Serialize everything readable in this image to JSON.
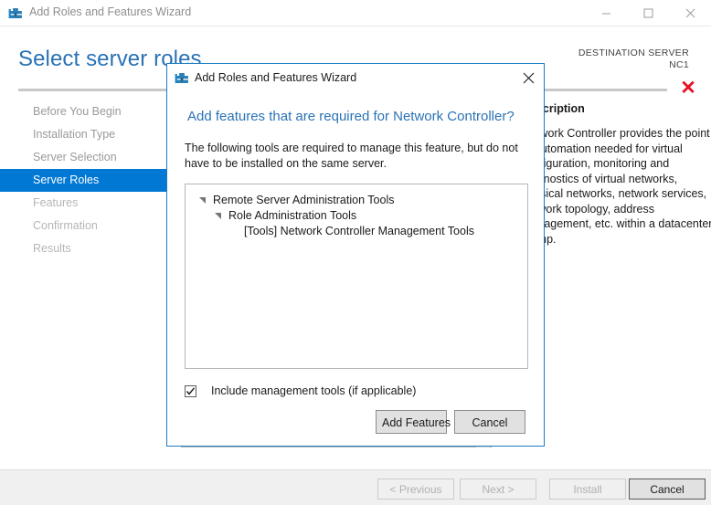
{
  "window": {
    "title": "Add Roles and Features Wizard",
    "icon": "toolbox-icon",
    "controls": {
      "minimize": "minimize-icon",
      "maximize": "maximize-icon",
      "close": "close-icon"
    }
  },
  "page": {
    "title": "Select server roles",
    "destination_label": "DESTINATION SERVER",
    "destination_server": "NC1",
    "error_marker": "✕"
  },
  "nav": {
    "items": [
      {
        "label": "Before You Begin",
        "state": "visited"
      },
      {
        "label": "Installation Type",
        "state": "visited"
      },
      {
        "label": "Server Selection",
        "state": "visited"
      },
      {
        "label": "Server Roles",
        "state": "selected"
      },
      {
        "label": "Features",
        "state": "disabled"
      },
      {
        "label": "Confirmation",
        "state": "disabled"
      },
      {
        "label": "Results",
        "state": "disabled"
      }
    ]
  },
  "description_panel": {
    "title": "Description",
    "body": "Network Controller provides the point of automation needed for virtual configuration, monitoring and diagnostics of virtual networks, physical networks, network services, network topology, address management, etc. within a datacenter stamp."
  },
  "dialog": {
    "title": "Add Roles and Features Wizard",
    "icon": "toolbox-icon",
    "close_icon": "close-icon",
    "heading": "Add features that are required for Network Controller?",
    "body": "The following tools are required to manage this feature, but do not have to be installed on the same server.",
    "tree": [
      {
        "label": "Remote Server Administration Tools",
        "level": 0,
        "expanded": true
      },
      {
        "label": "Role Administration Tools",
        "level": 1,
        "expanded": true
      },
      {
        "label": "[Tools] Network Controller Management Tools",
        "level": 2,
        "expanded": false
      }
    ],
    "checkbox": {
      "label": "Include management tools (if applicable)",
      "checked": true
    },
    "buttons": {
      "add_features": "Add Features",
      "cancel": "Cancel"
    }
  },
  "footer": {
    "previous": "< Previous",
    "next": "Next >",
    "install": "Install",
    "cancel": "Cancel"
  },
  "colors": {
    "accent": "#0078d4",
    "heading_blue": "#2a72b5",
    "error_red": "#e81123",
    "dialog_border": "#1d7dc4"
  }
}
